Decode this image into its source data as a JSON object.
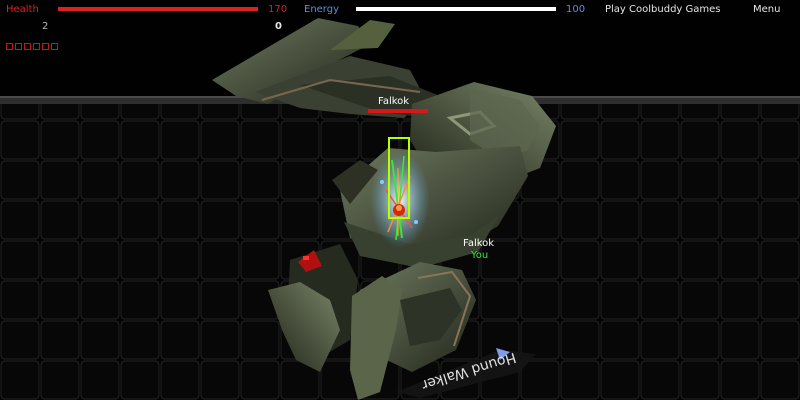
{
  "hud": {
    "health": {
      "label": "Health",
      "value": "170",
      "fraction": 1.0,
      "color": "#e01f1f"
    },
    "energy": {
      "label": "Energy",
      "value": "100",
      "fraction": 1.0,
      "color": "#ffffff"
    },
    "label_colors": {
      "health": "#e01f1f",
      "energy": "#5a8ee8"
    },
    "play_link": "Play Coolbuddy Games",
    "menu_link": "Menu",
    "kills": "2",
    "ammo": "0",
    "grenades": {
      "slots": 6,
      "filled": 0,
      "color": "#c41818"
    }
  },
  "world": {
    "enemy": {
      "name": "Falkok",
      "health_fraction": 1.0,
      "health_color": "#d81818"
    },
    "player": {
      "name": "Falkok",
      "tag": "You",
      "tag_color": "#3ee43e"
    },
    "vehicle": {
      "name": "Hound Walker"
    }
  },
  "colors": {
    "background": "#010101",
    "grid": "#1d1d1d",
    "ground_edge": "#3a3a3a",
    "mech_hull": "#454c3b",
    "mech_highlight": "#6e7a5e",
    "mech_shadow": "#222619",
    "target_box": "#b8ff00",
    "accent_red": "#b01010"
  },
  "icons": [
    "target-box-icon",
    "plasma-glow-icon",
    "mech-sensor-icon"
  ]
}
